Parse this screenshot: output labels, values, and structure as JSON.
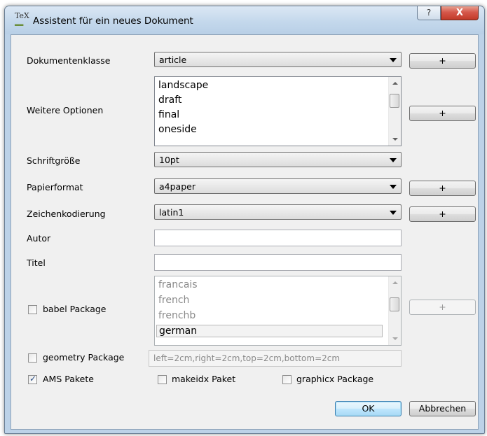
{
  "window": {
    "title": "Assistent für ein neues Dokument",
    "icon_text": "TeX",
    "help_glyph": "?",
    "close_glyph": "X"
  },
  "fields": {
    "document_class": {
      "label": "Dokumentenklasse",
      "value": "article",
      "add_label": "+"
    },
    "more_options": {
      "label": "Weitere Optionen",
      "items": [
        "landscape",
        "draft",
        "final",
        "oneside"
      ],
      "add_label": "+"
    },
    "font_size": {
      "label": "Schriftgröße",
      "value": "10pt"
    },
    "paper_format": {
      "label": "Papierformat",
      "value": "a4paper",
      "add_label": "+"
    },
    "encoding": {
      "label": "Zeichenkodierung",
      "value": "latin1",
      "add_label": "+"
    },
    "author": {
      "label": "Autor",
      "value": ""
    },
    "title": {
      "label": "Titel",
      "value": ""
    }
  },
  "babel": {
    "label": "babel Package",
    "checked": false,
    "items": [
      "francais",
      "french",
      "frenchb",
      "german"
    ],
    "selected": "german",
    "add_label": "+"
  },
  "geometry": {
    "label": "geometry Package",
    "checked": false,
    "value": "left=2cm,right=2cm,top=2cm,bottom=2cm"
  },
  "ams": {
    "label": "AMS Pakete",
    "checked": true
  },
  "makeidx": {
    "label": "makeidx Paket",
    "checked": false
  },
  "graphicx": {
    "label": "graphicx Package",
    "checked": false
  },
  "buttons": {
    "ok": "OK",
    "cancel": "Abbrechen"
  },
  "check_glyph": "✓"
}
